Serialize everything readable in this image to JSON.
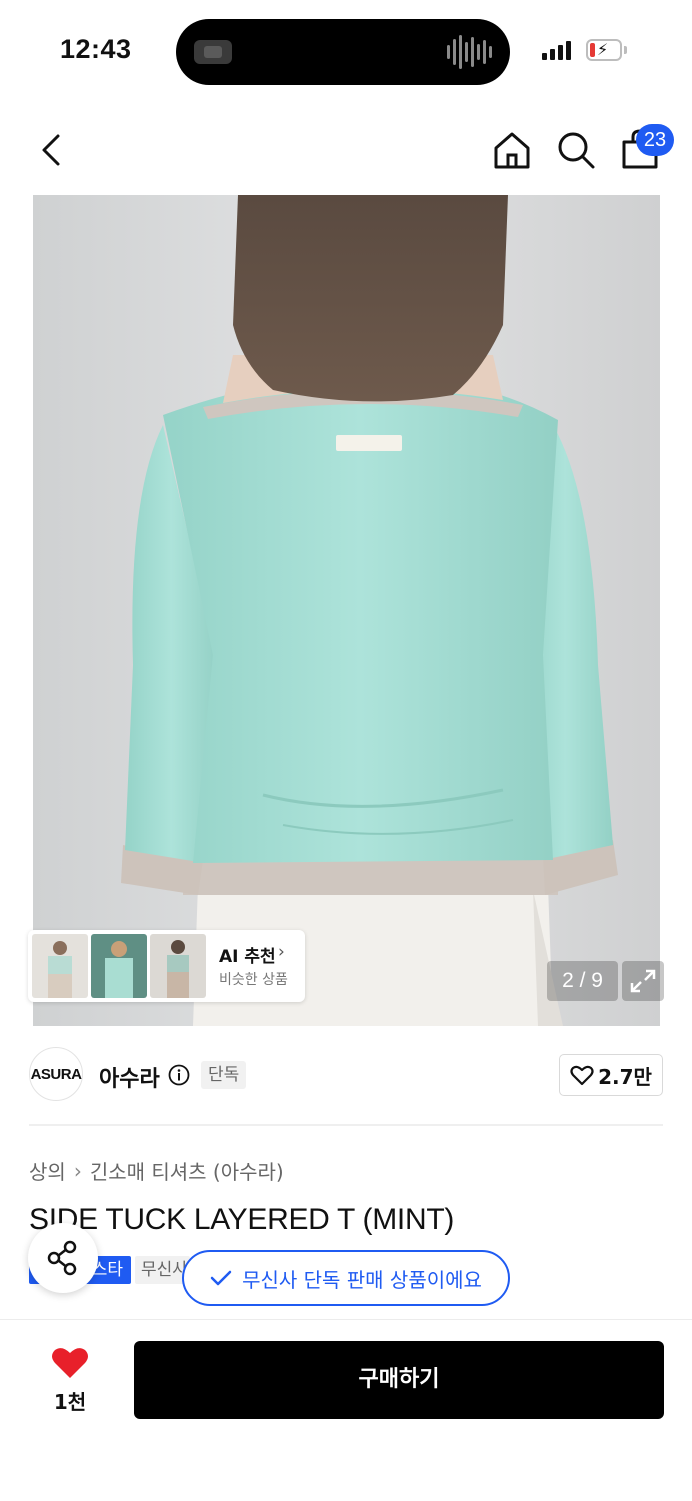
{
  "status_bar": {
    "time": "12:43"
  },
  "nav": {
    "cart_count": "23",
    "icons": [
      "chevron-left-icon",
      "home-icon",
      "search-icon",
      "shopping-bag-icon"
    ]
  },
  "gallery": {
    "pager": "2 / 9",
    "ai": {
      "title": "AI 추천",
      "subtitle": "비슷한 상품"
    }
  },
  "brand": {
    "logo_text": "ASURA",
    "name": "아수라",
    "tag": "단독",
    "likes": "2.7만"
  },
  "product": {
    "breadcrumb": [
      "상의",
      "긴소매 티셔츠 (아수라)"
    ],
    "title": "SIDE TUCK LAYERED T (MINT)",
    "badge_blue": "스타",
    "badge_gray": "무신사",
    "exclusive_notice": "무신사 단독 판매 상품이에요"
  },
  "bottom": {
    "heart_count": "1천",
    "buy_label": "구매하기"
  },
  "colors": {
    "accent": "#1f5bf2",
    "heart": "#e8202a",
    "shirt": "#a8e0d6"
  }
}
